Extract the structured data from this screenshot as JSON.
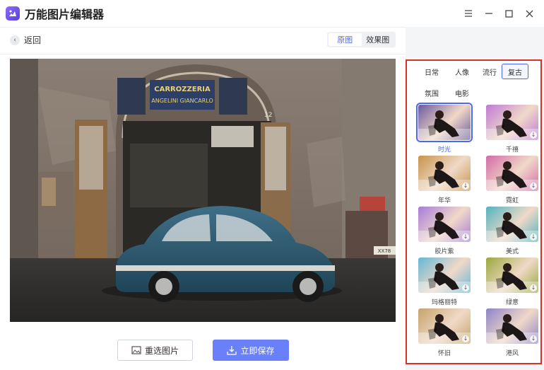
{
  "app": {
    "title": "万能图片编辑器",
    "icon": "image-edit-icon"
  },
  "window": {
    "controls": [
      "menu-icon",
      "minimize-icon",
      "maximize-icon",
      "close-icon"
    ]
  },
  "toolbar": {
    "back_label": "返回",
    "view_tabs": [
      {
        "label": "原图",
        "active": true
      },
      {
        "label": "效果图",
        "active": false
      }
    ]
  },
  "photo": {
    "sign_line1": "CARROZZERIA",
    "sign_line2": "ANGELINI GIANCARLO",
    "house_number": "12",
    "plate": "XX78"
  },
  "actions": {
    "reselect_label": "重选图片",
    "save_label": "立即保存"
  },
  "filters": {
    "categories": [
      "日常",
      "人像",
      "流行",
      "复古",
      "氛围",
      "电影"
    ],
    "active_category": "复古",
    "items": [
      {
        "label": "时光",
        "selected": true,
        "tint": "#6b5a9c"
      },
      {
        "label": "千禧",
        "selected": false,
        "tint": "#c07ad6"
      },
      {
        "label": "年华",
        "selected": false,
        "tint": "#c8944a"
      },
      {
        "label": "霓虹",
        "selected": false,
        "tint": "#d46aa8"
      },
      {
        "label": "胶片紫",
        "selected": false,
        "tint": "#a67bd9"
      },
      {
        "label": "美式",
        "selected": false,
        "tint": "#4fb4bf"
      },
      {
        "label": "玛格丽特",
        "selected": false,
        "tint": "#66b7d6"
      },
      {
        "label": "绿意",
        "selected": false,
        "tint": "#9aa83a"
      },
      {
        "label": "怀旧",
        "selected": false,
        "tint": "#c6a36a"
      },
      {
        "label": "港风",
        "selected": false,
        "tint": "#8d83c9"
      }
    ]
  },
  "colors": {
    "accent": "#4b67f5",
    "save_button": "#6a80f8",
    "highlight_border": "#d9302c"
  }
}
